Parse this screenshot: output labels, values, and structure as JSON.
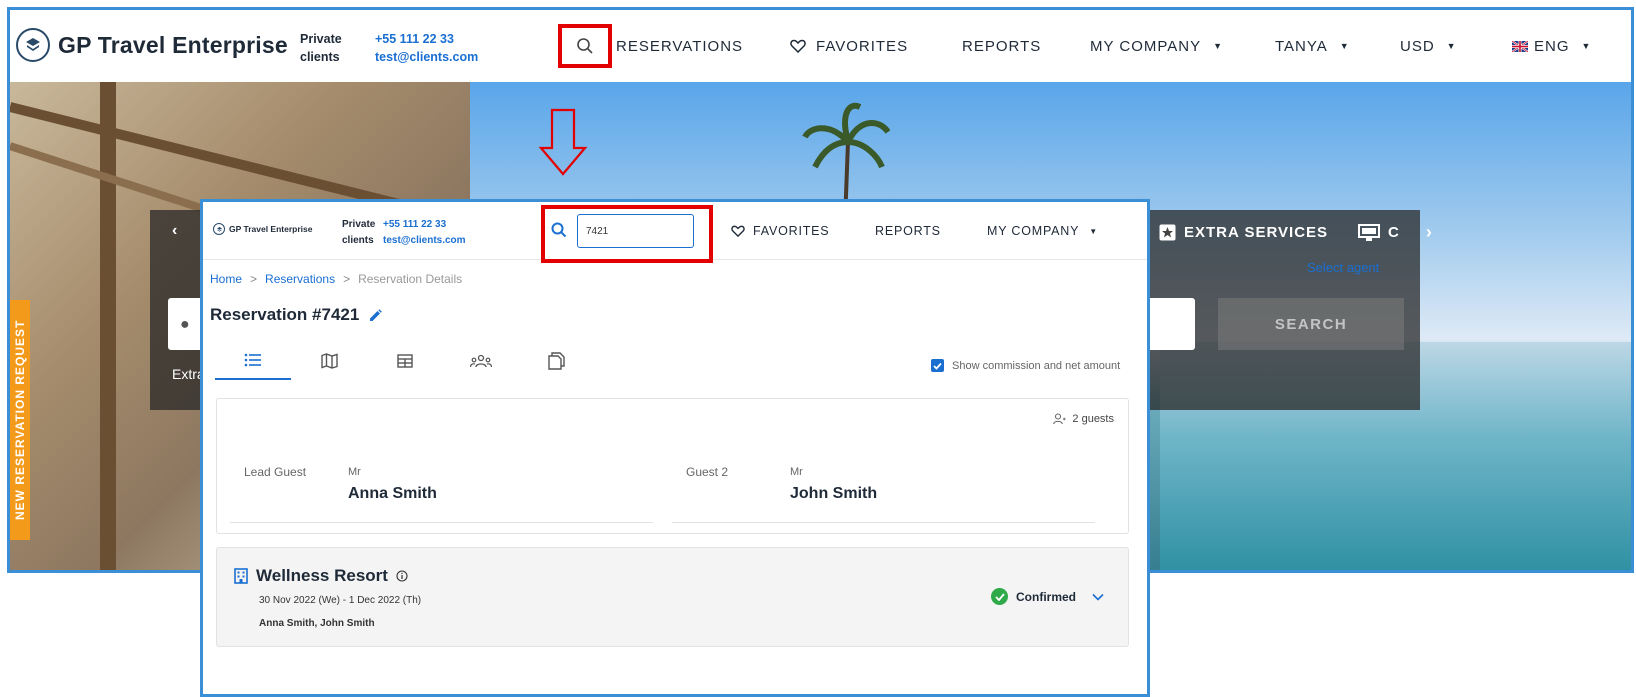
{
  "outer": {
    "logo_text": "GP Travel Enterprise",
    "contact_label_1": "Private",
    "contact_label_2": "clients",
    "contact_phone": "+55 111 22 33",
    "contact_email": "test@clients.com",
    "nav": {
      "reservations": "RESERVATIONS",
      "favorites": "FAVORITES",
      "reports": "REPORTS",
      "my_company": "MY COMPANY",
      "user": "TANYA",
      "currency": "USD",
      "language": "ENG"
    },
    "hero": {
      "new_reservation_request": "NEW RESERVATION REQUEST",
      "extra_services": "EXTRA SERVICES",
      "extra_services_next": "C",
      "select_agent": "Select agent",
      "search_button": "SEARCH",
      "extra_truncated": "Extra"
    }
  },
  "inner": {
    "logo_text": "GP Travel Enterprise",
    "contact_label_1": "Private",
    "contact_label_2": "clients",
    "contact_phone": "+55 111 22 33",
    "contact_email": "test@clients.com",
    "search_value": "7421",
    "nav": {
      "favorites": "FAVORITES",
      "reports": "REPORTS",
      "my_company": "MY COMPANY"
    },
    "breadcrumb": {
      "home": "Home",
      "reservations": "Reservations",
      "current": "Reservation Details",
      "sep": ">"
    },
    "page_title": "Reservation #7421",
    "commission_label": "Show commission and net amount",
    "guests": {
      "count_label": "2 guests",
      "lead": {
        "role": "Lead Guest",
        "title": "Mr",
        "name": "Anna Smith"
      },
      "second": {
        "role": "Guest 2",
        "title": "Mr",
        "name": "John Smith"
      }
    },
    "hotel": {
      "name": "Wellness Resort",
      "dates": "30 Nov 2022 (We) - 1 Dec 2022 (Th)",
      "guests": "Anna Smith, John Smith",
      "status": "Confirmed"
    }
  },
  "colors": {
    "accent": "#1a6fd1",
    "highlight": "#e20000",
    "frame": "#3a8fd6",
    "orange": "#f39a1b",
    "success": "#2eaa4a"
  },
  "icons": [
    "logo-icon",
    "search-icon",
    "heart-icon",
    "caret-down-icon",
    "uk-flag-icon",
    "arrow-down-icon",
    "edit-icon",
    "list-icon",
    "map-icon",
    "table-icon",
    "people-icon",
    "documents-icon",
    "checkbox-icon",
    "guests-icon",
    "building-icon",
    "info-icon",
    "check-circle-icon",
    "chevron-down-icon"
  ]
}
